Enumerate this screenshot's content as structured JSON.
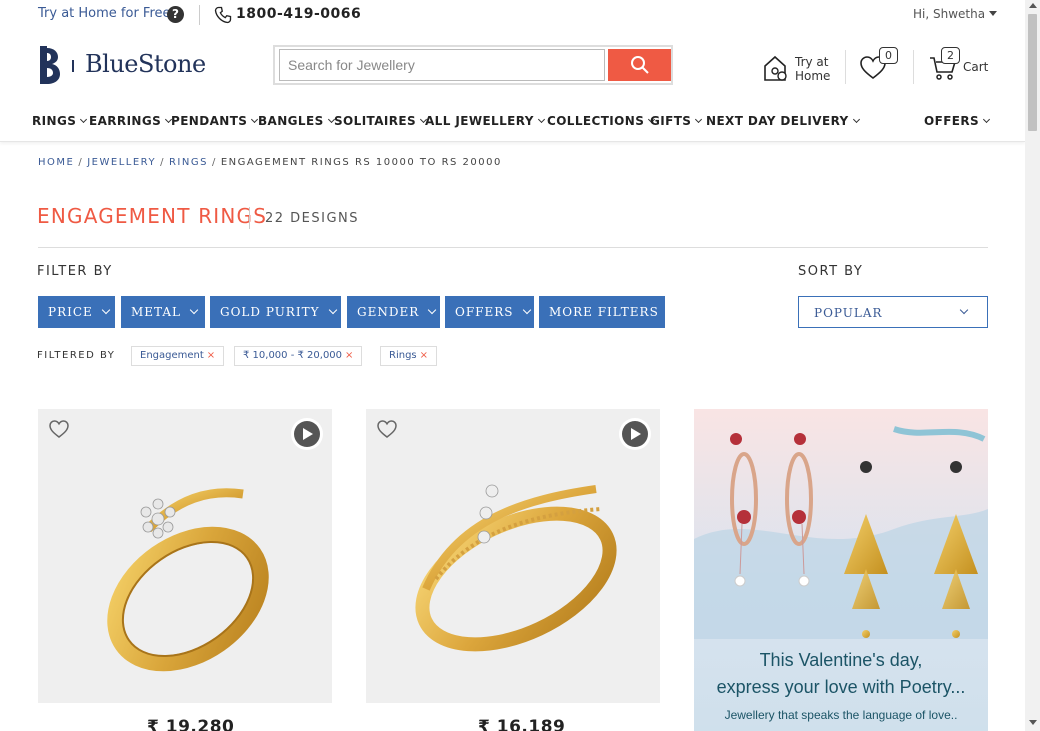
{
  "topbar": {
    "try_home": "Try at Home for Free",
    "phone": "1800-419-0066",
    "greeting": "Hi, Shwetha"
  },
  "header": {
    "logo_text": "BlueStone",
    "search_placeholder": "Search for Jewellery",
    "try_at_home_line1": "Try at",
    "try_at_home_line2": "Home",
    "wishlist_count": "0",
    "cart_count": "2",
    "cart_label": "Cart"
  },
  "nav": {
    "items": [
      "RINGS",
      "EARRINGS",
      "PENDANTS",
      "BANGLES",
      "SOLITAIRES",
      "ALL JEWELLERY",
      "COLLECTIONS",
      "GIFTS",
      "NEXT DAY DELIVERY",
      "OFFERS"
    ]
  },
  "breadcrumb": {
    "home": "HOME",
    "jewellery": "JEWELLERY",
    "rings": "RINGS",
    "current": "ENGAGEMENT RINGS RS 10000 TO RS 20000"
  },
  "listing": {
    "title": "ENGAGEMENT RINGS",
    "count": "22 DESIGNS",
    "filter_by": "FILTER BY",
    "sort_by": "SORT BY",
    "filters": [
      "PRICE",
      "METAL",
      "GOLD PURITY",
      "GENDER",
      "OFFERS",
      "MORE FILTERS"
    ],
    "sort_value": "POPULAR",
    "filtered_by": "FILTERED BY",
    "chips": [
      "Engagement",
      "₹ 10,000 - ₹ 20,000",
      "Rings"
    ]
  },
  "products": [
    {
      "price": "₹ 19,280"
    },
    {
      "price": "₹ 16,189"
    }
  ],
  "banner": {
    "line1": "This Valentine's day,",
    "line2": "express your love with Poetry...",
    "line3": "Jewellery that speaks the language of love.."
  },
  "colors": {
    "accent": "#ef5a44",
    "brand_blue": "#3a70b8",
    "navy": "#22335a"
  }
}
